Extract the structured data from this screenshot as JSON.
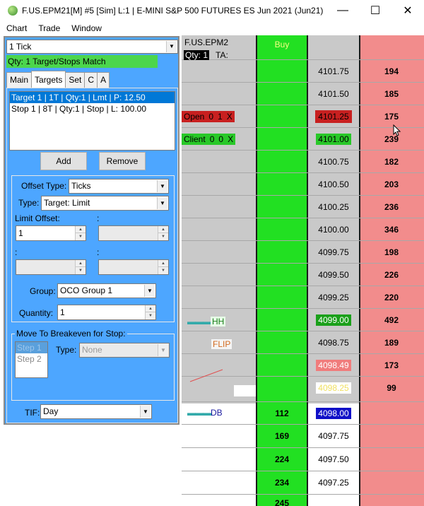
{
  "window": {
    "title": "F.US.EPM21[M]  #5 [Sim]  L:1 | E-MINI S&P 500 FUTURES ES Jun 2021 (Jun21)",
    "minimize": "—",
    "maximize": "☐",
    "close": "✕"
  },
  "menu": [
    "Chart",
    "Trade",
    "Window"
  ],
  "panel": {
    "tick_select": "1 Tick",
    "match_status": "Qty: 1 Target/Stops Match",
    "tabs": [
      "Main",
      "Targets",
      "Set",
      "C",
      "A"
    ],
    "active_tab": "Targets",
    "list_items": [
      "Target 1 | 1T | Qty:1 | Lmt | P: 12.50",
      "Stop 1 | 8T | Qty:1 | Stop | L: 100.00"
    ],
    "add_label": "Add",
    "remove_label": "Remove",
    "offset_type_label": "Offset Type:",
    "offset_type_value": "Ticks",
    "type_label": "Type:",
    "type_value": "Target: Limit",
    "limit_offset_label": "Limit Offset:",
    "colon_1": ":",
    "colon_2": ":",
    "colon_3": ":",
    "limit_offset_value": "1",
    "group_label": "Group:",
    "group_value": "OCO Group 1",
    "quantity_label": "Quantity:",
    "quantity_value": "1",
    "breakeven_legend": "Move To Breakeven for Stop:",
    "steps": [
      "Step 1",
      "Step 2"
    ],
    "be_type_label": "Type:",
    "be_type_value": "None",
    "tif_label": "TIF:",
    "tif_value": "Day"
  },
  "dom": {
    "symbol": "F.US.EPM2",
    "qty_label": "Qty: 1",
    "ta_label": "TA:",
    "buy_header": "Buy",
    "prices": [
      "4101.75",
      "4101.50",
      "4101.25",
      "4101.00",
      "4100.75",
      "4100.50",
      "4100.25",
      "4100.00",
      "4099.75",
      "4099.50",
      "4099.25",
      "4099.00",
      "4098.75",
      "4098.49",
      "4098.25",
      "4098.00",
      "4097.75",
      "4097.50",
      "4097.25"
    ],
    "sell_sizes": [
      "194",
      "185",
      "175",
      "239",
      "182",
      "203",
      "236",
      "346",
      "198",
      "226",
      "220",
      "492",
      "189",
      "173",
      "99"
    ],
    "buy_sizes": [
      "112",
      "169",
      "224",
      "234",
      "245"
    ],
    "open_order": [
      "Open",
      "0",
      "1",
      "X"
    ],
    "client_order": [
      "Client",
      "0",
      "0",
      "X"
    ],
    "note_hh": "HH",
    "note_flip": "FLIP",
    "note_db": "DB",
    "dash_marks": "▬▬▬"
  }
}
